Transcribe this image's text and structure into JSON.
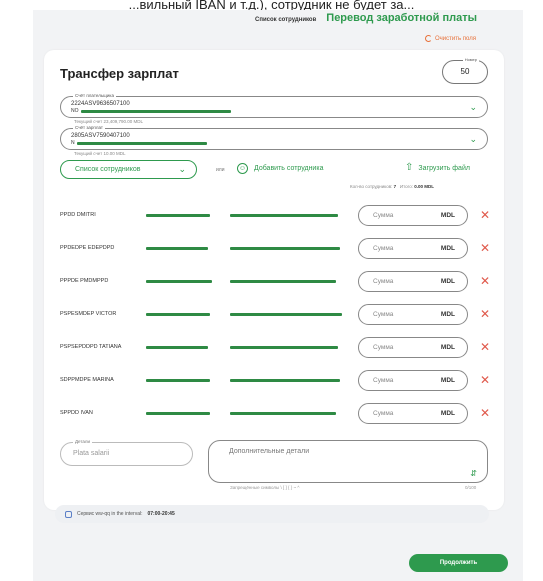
{
  "top_caption": "...вильный IBAN и т.д.), сотрудник не будет за...",
  "header": {
    "tab_employees": "Список сотрудников",
    "tab_salary": "Перевод заработной платы",
    "clear_fields": "Очистить поля"
  },
  "form": {
    "title": "Трансфер зарплат",
    "number_label": "Номер",
    "number_value": "50",
    "payer_account": {
      "label": "Счёт плательщика",
      "value": "2224ASV9636507100",
      "prefix": "NO",
      "balance": "Текущий счет 23,409,790.00 MDL"
    },
    "salary_account": {
      "label": "Счёт зарплат",
      "value": "2805ASV7590407100",
      "prefix": "N",
      "balance": "Текущий счет 10.00 MDL"
    },
    "employee_list_btn": "Список сотрудников",
    "or_text": "или",
    "add_employee": "Добавить сотрудника",
    "upload_file": "Загрузить файл",
    "count_label": "Кол-во сотрудников:",
    "count_value": "7",
    "total_label": "Итого:",
    "total_value": "0.00 MDL",
    "amount_placeholder": "Сумма",
    "currency": "MDL",
    "employees": [
      {
        "name": "PPDD DMITRI"
      },
      {
        "name": "PPDEDPE EDEPDPD"
      },
      {
        "name": "PPPDE PMDMPPD"
      },
      {
        "name": "PSPESMDEP VICTOR"
      },
      {
        "name": "PSPSEPDDPD TATIANA"
      },
      {
        "name": "SDPPMDPE MARINA"
      },
      {
        "name": "SPPDD IVAN"
      }
    ],
    "details_label": "Детали",
    "details_value": "Plata salarii",
    "extra_placeholder": "Дополнительные детали",
    "chars_hint": "Запрещённые символы \\ [ ] { } ~ ^",
    "chars_count": "0/100",
    "info_text_pre": "Сервис ww-qq in the interval:",
    "info_time": "07:00-20:45",
    "continue_btn": "Продолжить"
  },
  "colors": {
    "accent": "#2e9a4e",
    "delete": "#e05a4c",
    "clear": "#e8713a"
  }
}
